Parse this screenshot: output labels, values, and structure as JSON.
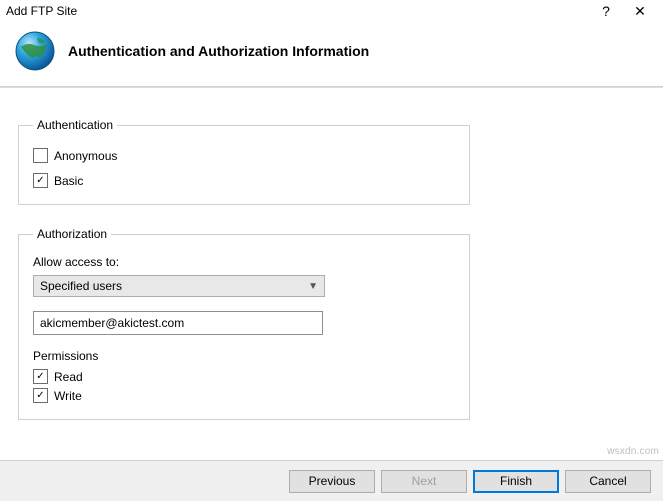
{
  "window": {
    "title": "Add FTP Site",
    "help": "?",
    "close": "✕"
  },
  "header": {
    "title": "Authentication and Authorization Information"
  },
  "auth": {
    "legend": "Authentication",
    "anonymous": {
      "label": "Anonymous",
      "checked": false
    },
    "basic": {
      "label": "Basic",
      "checked": true
    }
  },
  "authorization": {
    "legend": "Authorization",
    "allow_label": "Allow access to:",
    "select_value": "Specified users",
    "user_value": "akicmember@akictest.com",
    "permissions_label": "Permissions",
    "read": {
      "label": "Read",
      "checked": true
    },
    "write": {
      "label": "Write",
      "checked": true
    }
  },
  "footer": {
    "previous": "Previous",
    "next": "Next",
    "finish": "Finish",
    "cancel": "Cancel"
  },
  "watermark": "wsxdn.com",
  "check_glyph": "✓"
}
